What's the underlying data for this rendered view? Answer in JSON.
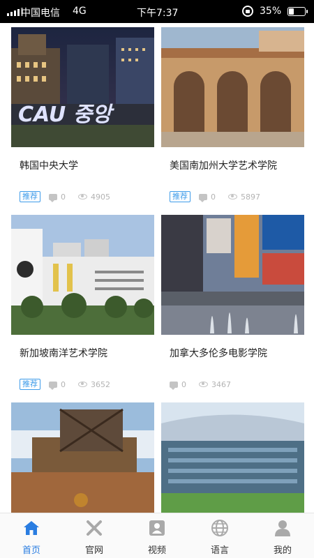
{
  "status_bar": {
    "carrier": "中国电信",
    "network": "4G",
    "time": "下午7:37",
    "battery_text": "35%",
    "battery_level": 0.35
  },
  "colors": {
    "accent": "#2a7de1",
    "tag": "#3d9be9",
    "muted": "#b3b3b3"
  },
  "cards": [
    {
      "title": "韩国中央大学",
      "tag": "推荐",
      "comments": "0",
      "views": "4905"
    },
    {
      "title": "美国南加州大学艺术学院",
      "tag": "推荐",
      "comments": "0",
      "views": "5897"
    },
    {
      "title": "新加坡南洋艺术学院",
      "tag": "推荐",
      "comments": "0",
      "views": "3652"
    },
    {
      "title": "加拿大多伦多电影学院",
      "tag": "",
      "comments": "0",
      "views": "3467"
    },
    {
      "title": "",
      "tag": "",
      "comments": "",
      "views": ""
    },
    {
      "title": "",
      "tag": "",
      "comments": "",
      "views": ""
    }
  ],
  "photo_overlay_text": "CAU 중앙",
  "tab_bar": {
    "tabs": [
      {
        "label": "首页",
        "icon": "home-icon",
        "active": true
      },
      {
        "label": "官网",
        "icon": "crossed-tools-icon",
        "active": false
      },
      {
        "label": "视频",
        "icon": "video-person-icon",
        "active": false
      },
      {
        "label": "语言",
        "icon": "globe-icon",
        "active": false
      },
      {
        "label": "我的",
        "icon": "profile-icon",
        "active": false
      }
    ]
  }
}
